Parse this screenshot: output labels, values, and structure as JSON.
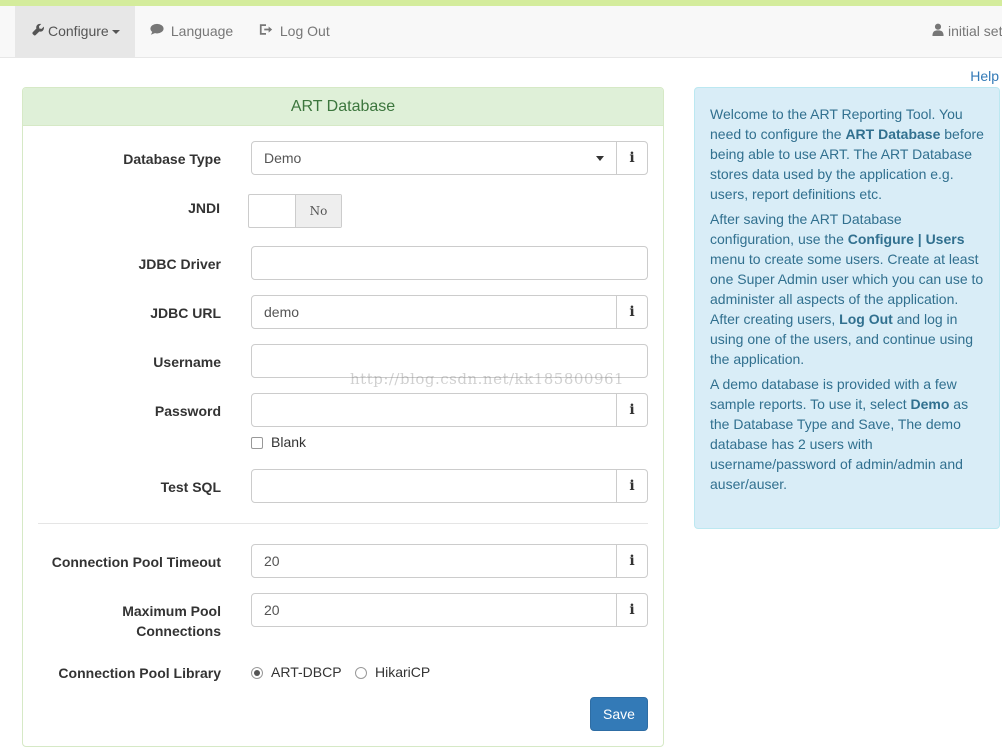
{
  "nav": {
    "configure": "Configure",
    "language": "Language",
    "logout": "Log Out",
    "user": "initial setu"
  },
  "help": "Help",
  "panel": {
    "title": "ART Database"
  },
  "form": {
    "database_type": {
      "label": "Database Type",
      "value": "Demo",
      "info": "i"
    },
    "jndi": {
      "label": "JNDI",
      "toggle": "No"
    },
    "jdbc_driver": {
      "label": "JDBC Driver",
      "value": ""
    },
    "jdbc_url": {
      "label": "JDBC URL",
      "value": "demo",
      "info": "i"
    },
    "username": {
      "label": "Username",
      "value": ""
    },
    "password": {
      "label": "Password",
      "value": "",
      "info": "i",
      "blank_label": "Blank"
    },
    "test_sql": {
      "label": "Test SQL",
      "value": "",
      "info": "i"
    },
    "pool_timeout": {
      "label": "Connection Pool Timeout",
      "value": "20",
      "info": "i"
    },
    "max_pool": {
      "label_line1": "Maximum Pool",
      "label_line2": "Connections",
      "value": "20",
      "info": "i"
    },
    "pool_library": {
      "label": "Connection Pool Library",
      "options": [
        "ART-DBCP",
        "HikariCP"
      ],
      "selected": "ART-DBCP"
    },
    "save": "Save"
  },
  "watermark": "http://blog.csdn.net/kk185800961",
  "info": {
    "p1_a": "Welcome to the ART Reporting Tool. You need to configure the ",
    "p1_b": "ART Database",
    "p1_c": " before being able to use ART. The ART Database stores data used by the application e.g. users, report definitions etc.",
    "p2_a": "After saving the ART Database configuration, use the ",
    "p2_b": "Configure | Users",
    "p2_c": " menu to create some users. Create at least one Super Admin user which you can use to administer all aspects of the application. After creating users, ",
    "p2_d": "Log Out",
    "p2_e": " and log in using one of the users, and continue using the application.",
    "p3_a": "A demo database is provided with a few sample reports. To use it, select ",
    "p3_b": "Demo",
    "p3_c": " as the Database Type and Save, The demo database has 2 users with username/password of admin/admin and auser/auser."
  },
  "colors": {
    "primary": "#337ab7",
    "panel_heading_bg": "#dff0d8",
    "info_bg": "#d9edf7",
    "top_strip": "#d4ec9c"
  },
  "icons": {
    "configure": "wrench-icon",
    "language": "comment-icon",
    "logout": "logout-icon",
    "user": "user-icon",
    "info": "info-icon"
  }
}
